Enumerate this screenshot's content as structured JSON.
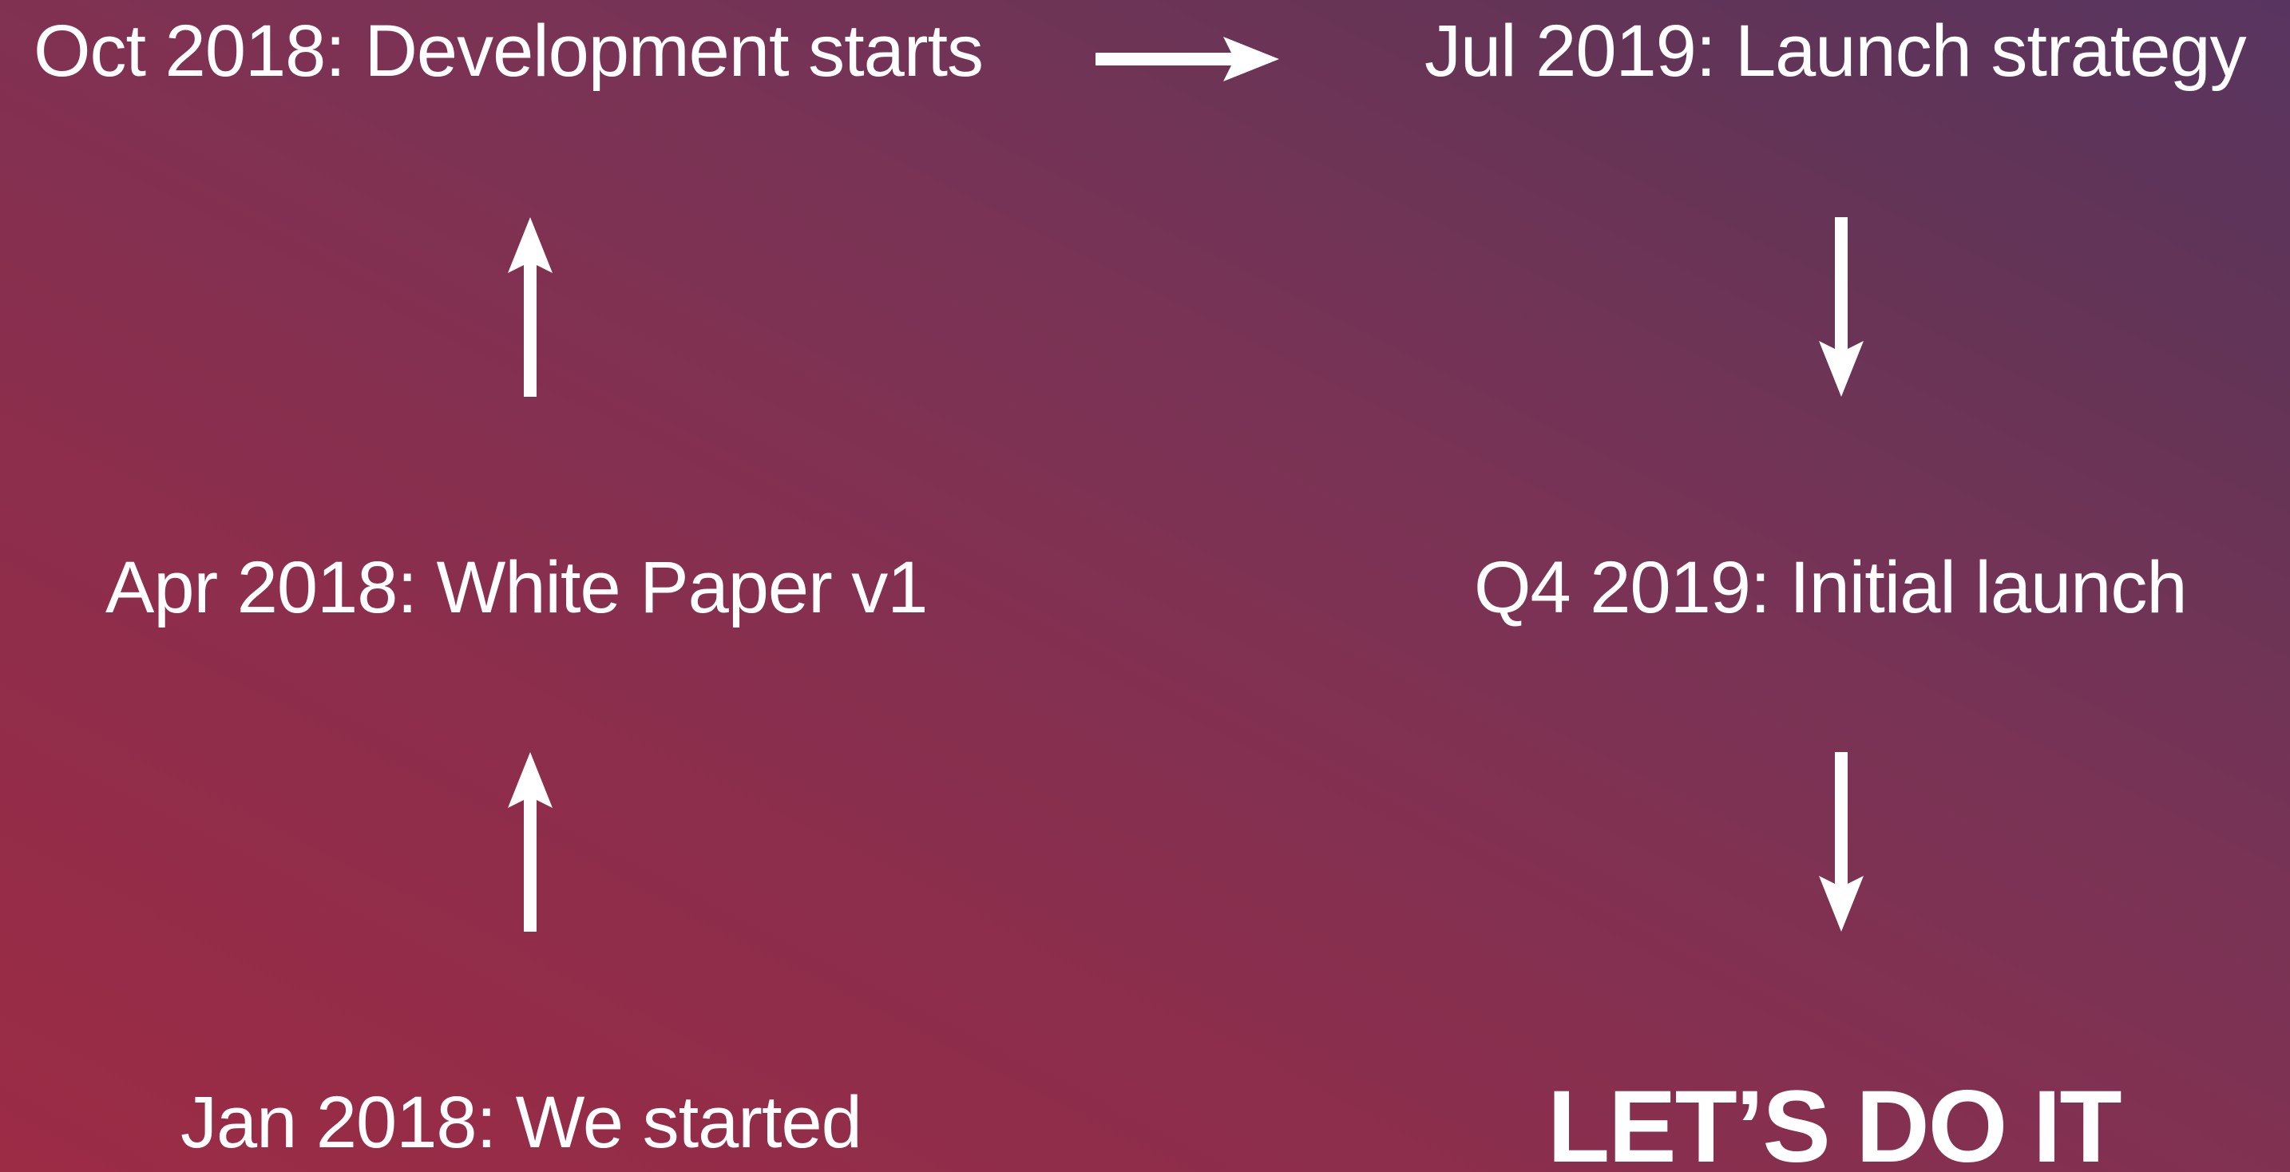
{
  "timeline": {
    "milestones": [
      {
        "label": "Jan 2018: We started"
      },
      {
        "label": "Apr 2018: White Paper v1"
      },
      {
        "label": "Oct 2018: Development starts"
      },
      {
        "label": "Jul 2019: Launch strategy"
      },
      {
        "label": "Q4 2019: Initial launch"
      }
    ],
    "final_label": "LET’S DO IT"
  },
  "colors": {
    "background_start": "#9c2b45",
    "background_end": "#583560",
    "text": "#ffffff",
    "arrow": "#ffffff"
  }
}
